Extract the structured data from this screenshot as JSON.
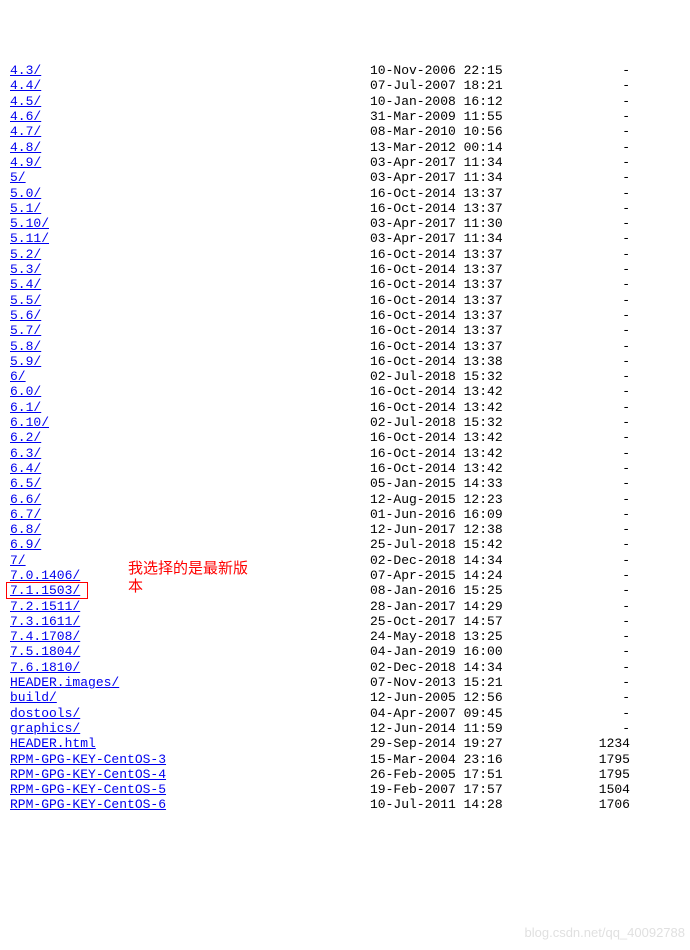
{
  "annotation": "我选择的是最新版本",
  "watermark": "blog.csdn.net/qq_40092788",
  "name_col_width_chars": 45,
  "entries": [
    {
      "name": "4.3/",
      "is_link": true,
      "date": "10-Nov-2006 22:15",
      "size": "-"
    },
    {
      "name": "4.4/",
      "is_link": true,
      "date": "07-Jul-2007 18:21",
      "size": "-"
    },
    {
      "name": "4.5/",
      "is_link": true,
      "date": "10-Jan-2008 16:12",
      "size": "-"
    },
    {
      "name": "4.6/",
      "is_link": true,
      "date": "31-Mar-2009 11:55",
      "size": "-"
    },
    {
      "name": "4.7/",
      "is_link": true,
      "date": "08-Mar-2010 10:56",
      "size": "-"
    },
    {
      "name": "4.8/",
      "is_link": true,
      "date": "13-Mar-2012 00:14",
      "size": "-"
    },
    {
      "name": "4.9/",
      "is_link": true,
      "date": "03-Apr-2017 11:34",
      "size": "-"
    },
    {
      "name": "5/",
      "is_link": true,
      "date": "03-Apr-2017 11:34",
      "size": "-"
    },
    {
      "name": "5.0/",
      "is_link": true,
      "date": "16-Oct-2014 13:37",
      "size": "-"
    },
    {
      "name": "5.1/",
      "is_link": true,
      "date": "16-Oct-2014 13:37",
      "size": "-"
    },
    {
      "name": "5.10/",
      "is_link": true,
      "date": "03-Apr-2017 11:30",
      "size": "-"
    },
    {
      "name": "5.11/",
      "is_link": true,
      "date": "03-Apr-2017 11:34",
      "size": "-"
    },
    {
      "name": "5.2/",
      "is_link": true,
      "date": "16-Oct-2014 13:37",
      "size": "-"
    },
    {
      "name": "5.3/",
      "is_link": true,
      "date": "16-Oct-2014 13:37",
      "size": "-"
    },
    {
      "name": "5.4/",
      "is_link": true,
      "date": "16-Oct-2014 13:37",
      "size": "-"
    },
    {
      "name": "5.5/",
      "is_link": true,
      "date": "16-Oct-2014 13:37",
      "size": "-"
    },
    {
      "name": "5.6/",
      "is_link": true,
      "date": "16-Oct-2014 13:37",
      "size": "-"
    },
    {
      "name": "5.7/",
      "is_link": true,
      "date": "16-Oct-2014 13:37",
      "size": "-"
    },
    {
      "name": "5.8/",
      "is_link": true,
      "date": "16-Oct-2014 13:37",
      "size": "-"
    },
    {
      "name": "5.9/",
      "is_link": true,
      "date": "16-Oct-2014 13:38",
      "size": "-"
    },
    {
      "name": "6/",
      "is_link": true,
      "date": "02-Jul-2018 15:32",
      "size": "-"
    },
    {
      "name": "6.0/",
      "is_link": true,
      "date": "16-Oct-2014 13:42",
      "size": "-"
    },
    {
      "name": "6.1/",
      "is_link": true,
      "date": "16-Oct-2014 13:42",
      "size": "-"
    },
    {
      "name": "6.10/",
      "is_link": true,
      "date": "02-Jul-2018 15:32",
      "size": "-"
    },
    {
      "name": "6.2/",
      "is_link": true,
      "date": "16-Oct-2014 13:42",
      "size": "-"
    },
    {
      "name": "6.3/",
      "is_link": true,
      "date": "16-Oct-2014 13:42",
      "size": "-"
    },
    {
      "name": "6.4/",
      "is_link": true,
      "date": "16-Oct-2014 13:42",
      "size": "-"
    },
    {
      "name": "6.5/",
      "is_link": true,
      "date": "05-Jan-2015 14:33",
      "size": "-"
    },
    {
      "name": "6.6/",
      "is_link": true,
      "date": "12-Aug-2015 12:23",
      "size": "-"
    },
    {
      "name": "6.7/",
      "is_link": true,
      "date": "01-Jun-2016 16:09",
      "size": "-"
    },
    {
      "name": "6.8/",
      "is_link": true,
      "date": "12-Jun-2017 12:38",
      "size": "-"
    },
    {
      "name": "6.9/",
      "is_link": true,
      "date": "25-Jul-2018 15:42",
      "size": "-"
    },
    {
      "name": "7/",
      "is_link": true,
      "date": "02-Dec-2018 14:34",
      "size": "-"
    },
    {
      "name": "7.0.1406/",
      "is_link": true,
      "date": "07-Apr-2015 14:24",
      "size": "-"
    },
    {
      "name": "7.1.1503/",
      "is_link": true,
      "date": "08-Jan-2016 15:25",
      "size": "-"
    },
    {
      "name": "7.2.1511/",
      "is_link": true,
      "date": "28-Jan-2017 14:29",
      "size": "-"
    },
    {
      "name": "7.3.1611/",
      "is_link": true,
      "date": "25-Oct-2017 14:57",
      "size": "-"
    },
    {
      "name": "7.4.1708/",
      "is_link": true,
      "date": "24-May-2018 13:25",
      "size": "-"
    },
    {
      "name": "7.5.1804/",
      "is_link": true,
      "date": "04-Jan-2019 16:00",
      "size": "-"
    },
    {
      "name": "7.6.1810/",
      "is_link": true,
      "date": "02-Dec-2018 14:34",
      "size": "-"
    },
    {
      "name": "HEADER.images/",
      "is_link": true,
      "date": "07-Nov-2013 15:21",
      "size": "-"
    },
    {
      "name": "build/",
      "is_link": true,
      "date": "12-Jun-2005 12:56",
      "size": "-"
    },
    {
      "name": "dostools/",
      "is_link": true,
      "date": "04-Apr-2007 09:45",
      "size": "-"
    },
    {
      "name": "graphics/",
      "is_link": true,
      "date": "12-Jun-2014 11:59",
      "size": "-"
    },
    {
      "name": "HEADER.html",
      "is_link": true,
      "date": "29-Sep-2014 19:27",
      "size": "1234"
    },
    {
      "name": "RPM-GPG-KEY-CentOS-3",
      "is_link": true,
      "date": "15-Mar-2004 23:16",
      "size": "1795"
    },
    {
      "name": "RPM-GPG-KEY-CentOS-4",
      "is_link": true,
      "date": "26-Feb-2005 17:51",
      "size": "1795"
    },
    {
      "name": "RPM-GPG-KEY-CentOS-5",
      "is_link": true,
      "date": "19-Feb-2007 17:57",
      "size": "1504"
    },
    {
      "name": "RPM-GPG-KEY-CentOS-6",
      "is_link": true,
      "date": "10-Jul-2011 14:28",
      "size": "1706"
    }
  ]
}
